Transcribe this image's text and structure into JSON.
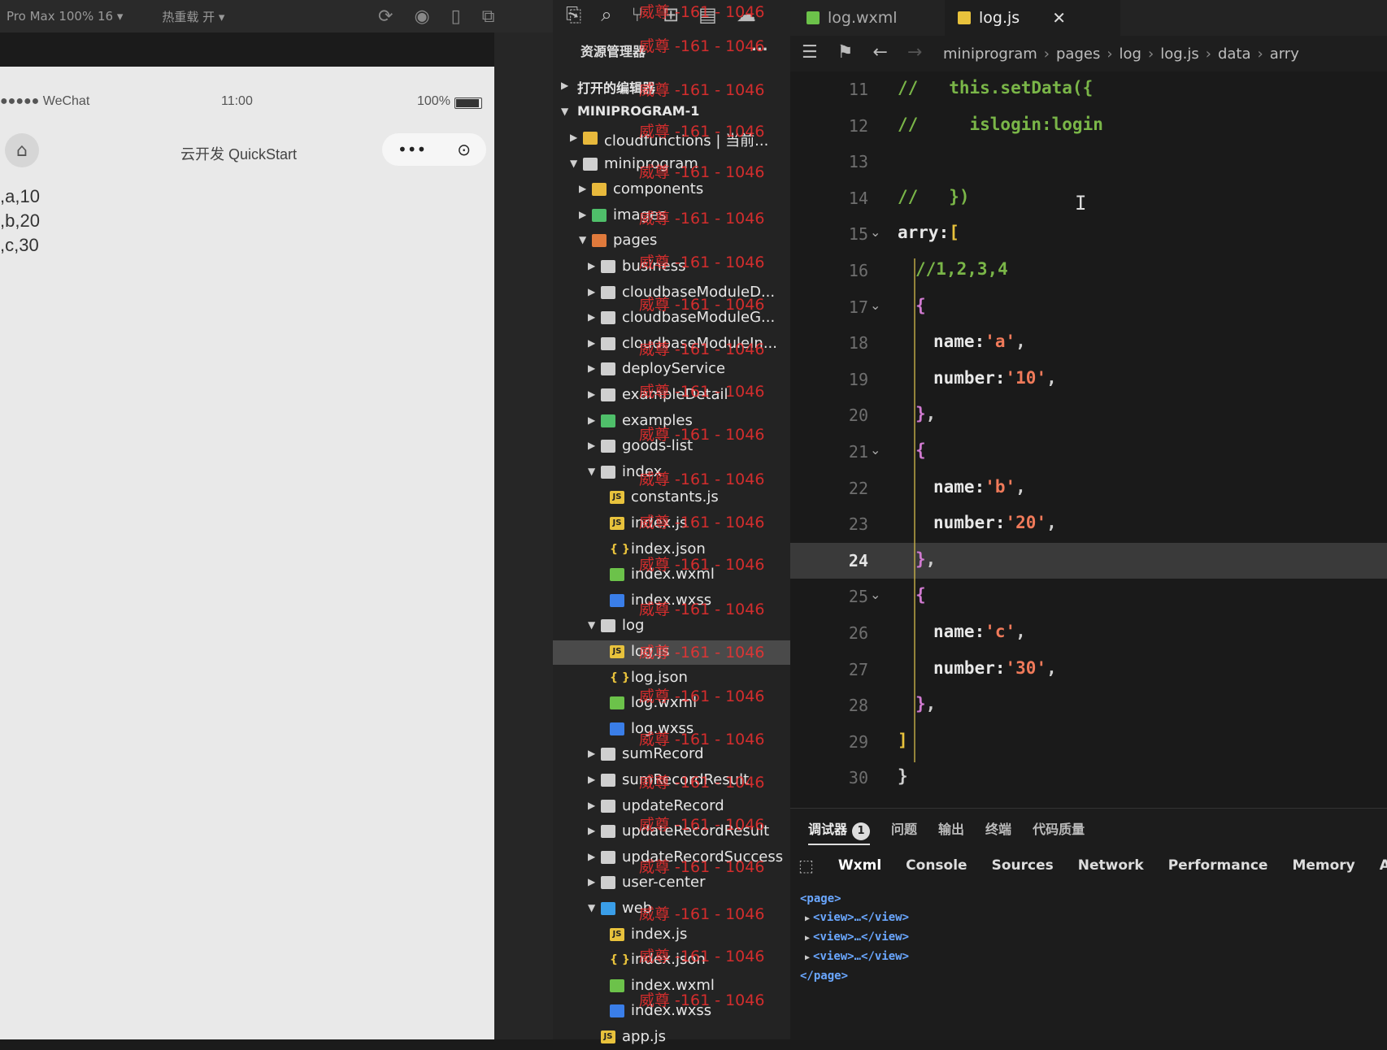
{
  "simulator": {
    "toolbar": {
      "device": "Pro Max 100% 16 ▾",
      "hot_reload": "热重载 开 ▾"
    },
    "status": {
      "carrier": "●●●●● WeChat",
      "time": "11:00",
      "battery": "100%"
    },
    "nav": {
      "title": "云开发 QuickStart",
      "more": "•••"
    },
    "lines": [
      ",a,10",
      ",b,20",
      ",c,30"
    ]
  },
  "explorer": {
    "header": "资源管理器",
    "more": "...",
    "open_editors": "打开的编辑器",
    "project": "MINIPROGRAM-1",
    "tree": [
      {
        "label": "cloudfunctions | 当前...",
        "arrow": "▶",
        "indent": 1,
        "icon": "folder-y"
      },
      {
        "label": "miniprogram",
        "arrow": "▼",
        "indent": 1,
        "icon": "folder"
      },
      {
        "label": "components",
        "arrow": "▶",
        "indent": 2,
        "icon": "folder-y"
      },
      {
        "label": "images",
        "arrow": "▶",
        "indent": 2,
        "icon": "folder-g"
      },
      {
        "label": "pages",
        "arrow": "▼",
        "indent": 2,
        "icon": "folder-o"
      },
      {
        "label": "business",
        "arrow": "▶",
        "indent": 3,
        "icon": "folder"
      },
      {
        "label": "cloudbaseModuleD...",
        "arrow": "▶",
        "indent": 3,
        "icon": "folder"
      },
      {
        "label": "cloudbaseModuleG...",
        "arrow": "▶",
        "indent": 3,
        "icon": "folder"
      },
      {
        "label": "cloudbaseModuleIn...",
        "arrow": "▶",
        "indent": 3,
        "icon": "folder"
      },
      {
        "label": "deployService",
        "arrow": "▶",
        "indent": 3,
        "icon": "folder"
      },
      {
        "label": "exampleDetail",
        "arrow": "▶",
        "indent": 3,
        "icon": "folder"
      },
      {
        "label": "examples",
        "arrow": "▶",
        "indent": 3,
        "icon": "folder-g"
      },
      {
        "label": "goods-list",
        "arrow": "▶",
        "indent": 3,
        "icon": "folder"
      },
      {
        "label": "index",
        "arrow": "▼",
        "indent": 3,
        "icon": "folder"
      },
      {
        "label": "constants.js",
        "arrow": "",
        "indent": 4,
        "icon": "file-js"
      },
      {
        "label": "index.js",
        "arrow": "",
        "indent": 4,
        "icon": "file-js"
      },
      {
        "label": "index.json",
        "arrow": "",
        "indent": 4,
        "icon": "file-json"
      },
      {
        "label": "index.wxml",
        "arrow": "",
        "indent": 4,
        "icon": "file-wxml"
      },
      {
        "label": "index.wxss",
        "arrow": "",
        "indent": 4,
        "icon": "file-wxss"
      },
      {
        "label": "log",
        "arrow": "▼",
        "indent": 3,
        "icon": "folder"
      },
      {
        "label": "log.js",
        "arrow": "",
        "indent": 4,
        "icon": "file-js",
        "selected": true
      },
      {
        "label": "log.json",
        "arrow": "",
        "indent": 4,
        "icon": "file-json"
      },
      {
        "label": "log.wxml",
        "arrow": "",
        "indent": 4,
        "icon": "file-wxml"
      },
      {
        "label": "log.wxss",
        "arrow": "",
        "indent": 4,
        "icon": "file-wxss"
      },
      {
        "label": "sumRecord",
        "arrow": "▶",
        "indent": 3,
        "icon": "folder"
      },
      {
        "label": "sumRecordResult",
        "arrow": "▶",
        "indent": 3,
        "icon": "folder"
      },
      {
        "label": "updateRecord",
        "arrow": "▶",
        "indent": 3,
        "icon": "folder"
      },
      {
        "label": "updateRecordResult",
        "arrow": "▶",
        "indent": 3,
        "icon": "folder"
      },
      {
        "label": "updateRecordSuccess",
        "arrow": "▶",
        "indent": 3,
        "icon": "folder"
      },
      {
        "label": "user-center",
        "arrow": "▶",
        "indent": 3,
        "icon": "folder"
      },
      {
        "label": "web",
        "arrow": "▼",
        "indent": 3,
        "icon": "folder-b"
      },
      {
        "label": "index.js",
        "arrow": "",
        "indent": 4,
        "icon": "file-js"
      },
      {
        "label": "index.json",
        "arrow": "",
        "indent": 4,
        "icon": "file-json"
      },
      {
        "label": "index.wxml",
        "arrow": "",
        "indent": 4,
        "icon": "file-wxml"
      },
      {
        "label": "index.wxss",
        "arrow": "",
        "indent": 4,
        "icon": "file-wxss"
      },
      {
        "label": "app.js",
        "arrow": "",
        "indent": 3,
        "icon": "file-js"
      }
    ]
  },
  "editor": {
    "tabs": [
      {
        "label": "log.wxml",
        "icon": "file-wxml"
      },
      {
        "label": "log.js",
        "icon": "file-js",
        "active": true
      }
    ],
    "breadcrumb": [
      "miniprogram",
      "pages",
      "log",
      "log.js",
      "data",
      "arry"
    ],
    "lines": [
      {
        "n": "11",
        "tokens": [
          [
            "c",
            "//   this.setData({"
          ]
        ],
        "indent": 0
      },
      {
        "n": "12",
        "tokens": [
          [
            "c",
            "//     islogin:login"
          ]
        ],
        "indent": 0
      },
      {
        "n": "13",
        "tokens": [],
        "indent": 0
      },
      {
        "n": "14",
        "tokens": [
          [
            "c",
            "//   })"
          ]
        ],
        "indent": 0
      },
      {
        "n": "15",
        "tokens": [
          [
            "k",
            "arry:"
          ],
          [
            "b",
            "["
          ]
        ],
        "indent": 0,
        "fold": true
      },
      {
        "n": "16",
        "tokens": [
          [
            "c",
            "//1,2,3,4"
          ]
        ],
        "indent": 1
      },
      {
        "n": "17",
        "tokens": [
          [
            "br",
            "{"
          ]
        ],
        "indent": 1,
        "fold": true
      },
      {
        "n": "18",
        "tokens": [
          [
            "k",
            "name:"
          ],
          [
            "s",
            "'a'"
          ],
          [
            "p",
            ","
          ]
        ],
        "indent": 2
      },
      {
        "n": "19",
        "tokens": [
          [
            "k",
            "number:"
          ],
          [
            "s",
            "'10'"
          ],
          [
            "p",
            ","
          ]
        ],
        "indent": 2
      },
      {
        "n": "20",
        "tokens": [
          [
            "br",
            "}"
          ],
          [
            "p",
            ","
          ]
        ],
        "indent": 1
      },
      {
        "n": "21",
        "tokens": [
          [
            "br",
            "{"
          ]
        ],
        "indent": 1,
        "fold": true
      },
      {
        "n": "22",
        "tokens": [
          [
            "k",
            "name:"
          ],
          [
            "s",
            "'b'"
          ],
          [
            "p",
            ","
          ]
        ],
        "indent": 2
      },
      {
        "n": "23",
        "tokens": [
          [
            "k",
            "number:"
          ],
          [
            "s",
            "'20'"
          ],
          [
            "p",
            ","
          ]
        ],
        "indent": 2
      },
      {
        "n": "24",
        "tokens": [
          [
            "br",
            "}"
          ],
          [
            "p",
            ","
          ]
        ],
        "indent": 1,
        "current": true
      },
      {
        "n": "25",
        "tokens": [
          [
            "br",
            "{"
          ]
        ],
        "indent": 1,
        "fold": true
      },
      {
        "n": "26",
        "tokens": [
          [
            "k",
            "name:"
          ],
          [
            "s",
            "'c'"
          ],
          [
            "p",
            ","
          ]
        ],
        "indent": 2
      },
      {
        "n": "27",
        "tokens": [
          [
            "k",
            "number:"
          ],
          [
            "s",
            "'30'"
          ],
          [
            "p",
            ","
          ]
        ],
        "indent": 2
      },
      {
        "n": "28",
        "tokens": [
          [
            "br",
            "}"
          ],
          [
            "p",
            ","
          ]
        ],
        "indent": 1
      },
      {
        "n": "29",
        "tokens": [
          [
            "b",
            "]"
          ]
        ],
        "indent": 0
      },
      {
        "n": "30",
        "tokens": [
          [
            "p",
            "}"
          ]
        ],
        "indent": 0
      }
    ]
  },
  "panel": {
    "tabs": [
      "调试器",
      "问题",
      "输出",
      "终端",
      "代码质量"
    ],
    "badge": "1",
    "devtools_tabs": [
      "Wxml",
      "Console",
      "Sources",
      "Network",
      "Performance",
      "Memory",
      "AppData"
    ],
    "dom": {
      "open": "<page>",
      "children": [
        "<view>…</view>",
        "<view>…</view>",
        "<view>…</view>"
      ],
      "close": "</page>"
    }
  },
  "watermark": "威尊 -161 - 1046"
}
